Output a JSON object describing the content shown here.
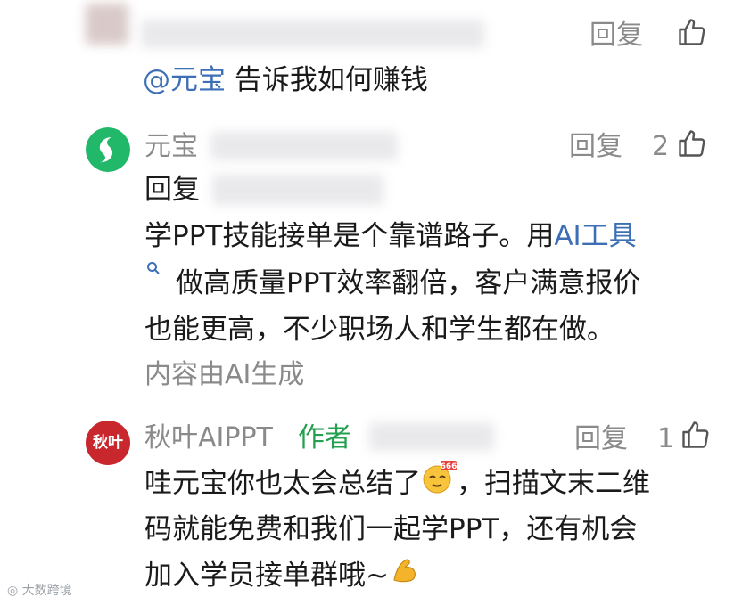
{
  "comment1": {
    "mention": "@元宝",
    "text": "告诉我如何赚钱",
    "reply_label": "回复"
  },
  "comment2": {
    "author": "元宝",
    "reply_label": "回复",
    "like_count": "2",
    "reply_prefix": "回复",
    "line1_text": "学PPT技能接单是个靠谱路子。用",
    "line1_link": "AI工具",
    "line2": "做高质量PPT效率翻倍，客户满意报价",
    "line3": "也能更高，不少职场人和学生都在做。",
    "ai_note": "内容由AI生成"
  },
  "comment3": {
    "avatar_text": "秋叶",
    "author": "秋叶AIPPT",
    "author_badge": "作者",
    "reply_label": "回复",
    "like_count": "1",
    "line1_a": "哇元宝你也太会总结了",
    "line1_b": "，扫描文末二维",
    "line2": "码就能免费和我们一起学PPT，还有机会",
    "line3": "加入学员接单群哦~",
    "emoji_666_text": "666"
  },
  "watermark": {
    "text": "大数跨境"
  },
  "colors": {
    "link": "#3d6fb6",
    "author_badge": "#22a04f",
    "muted": "#8a8a8a",
    "avatar_yuanbao": "#22b86a",
    "avatar_qiuye": "#c8272d"
  }
}
